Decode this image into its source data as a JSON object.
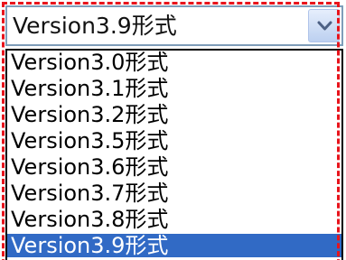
{
  "select": {
    "value": "Version3.9形式",
    "button_icon": "chevron-down-icon"
  },
  "options": [
    "Version3.0形式",
    "Version3.1形式",
    "Version3.2形式",
    "Version3.5形式",
    "Version3.6形式",
    "Version3.7形式",
    "Version3.8形式",
    "Version3.9形式"
  ],
  "colors": {
    "selection": "#316ac5",
    "highlight_border": "#e8141c"
  }
}
